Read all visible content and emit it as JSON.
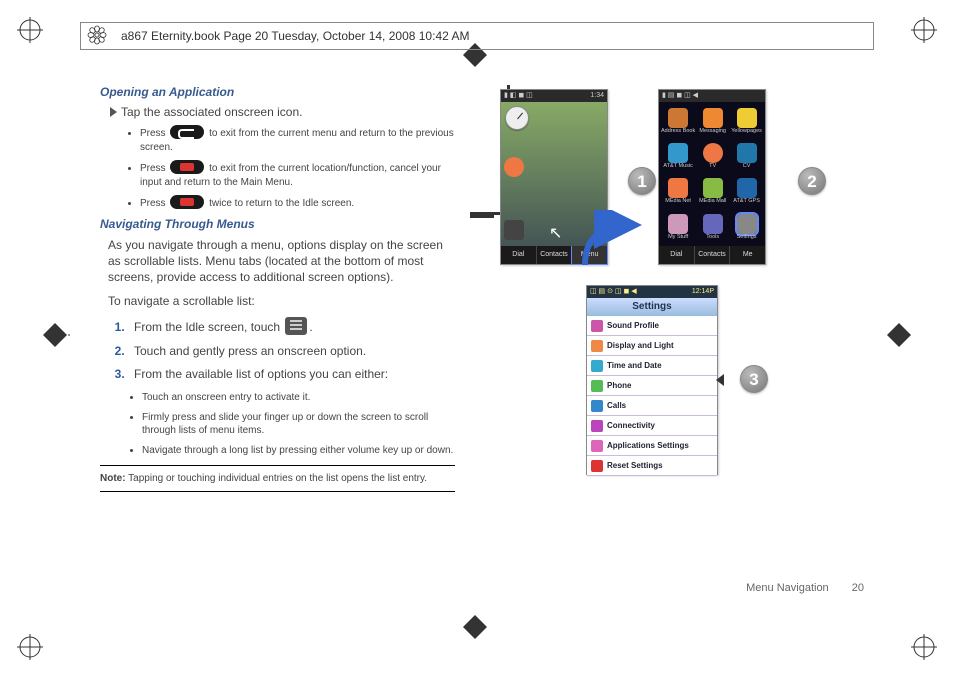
{
  "header": {
    "text": "a867 Eternity.book  Page 20  Tuesday, October 14, 2008  10:42 AM"
  },
  "section1": {
    "title": "Opening an Application",
    "tap_line": "Tap the associated onscreen icon.",
    "b1a": "Press ",
    "b1b": " to exit from the current menu and return to the previous screen.",
    "b2a": "Press ",
    "b2b": " to exit from the current location/function, cancel your input and return to the Main Menu.",
    "b3a": "Press ",
    "b3b": " twice to return to the Idle screen."
  },
  "section2": {
    "title": "Navigating Through Menus",
    "p1": "As you navigate through a menu, options display on the screen as scrollable lists. Menu tabs (located at the bottom of most screens, provide access to additional screen options).",
    "p2": "To navigate a scrollable list:",
    "ol1a": "From the Idle screen, touch ",
    "ol1b": ".",
    "ol2": "Touch and gently press an onscreen option.",
    "ol3": "From the available list of options you can either:",
    "sb1": "Touch an onscreen entry to activate it.",
    "sb2": "Firmly press and slide your finger up or down the screen to scroll through lists of menu items.",
    "sb3": "Navigate through a long list by pressing either volume key up or down."
  },
  "note": {
    "label": "Note:",
    "text": " Tapping or touching individual entries on the list opens the list entry."
  },
  "footer": {
    "section": "Menu Navigation",
    "page": "20"
  },
  "phone_idle": {
    "time": "1:34",
    "soft": {
      "dial": "Dial",
      "contacts": "Contacts",
      "menu": "Menu"
    }
  },
  "phone_grid": {
    "soft": {
      "dial": "Dial",
      "contacts": "Contacts",
      "me": "Me"
    },
    "apps": [
      {
        "label": "Address Book"
      },
      {
        "label": "Messaging"
      },
      {
        "label": "Yellowpages"
      },
      {
        "label": "AT&T Music"
      },
      {
        "label": "TV"
      },
      {
        "label": "CV"
      },
      {
        "label": "MEdia Net"
      },
      {
        "label": "MEdia Mall"
      },
      {
        "label": "AT&T GPS"
      },
      {
        "label": "My Stuff"
      },
      {
        "label": "Tools"
      },
      {
        "label": "Settings"
      }
    ]
  },
  "phone_settings": {
    "time": "12:14P",
    "title": "Settings",
    "rows": [
      "Sound Profile",
      "Display and Light",
      "Time and Date",
      "Phone",
      "Calls",
      "Connectivity",
      "Applications Settings",
      "Reset Settings"
    ]
  },
  "callouts": {
    "c1": "1",
    "c2": "2",
    "c3": "3"
  }
}
